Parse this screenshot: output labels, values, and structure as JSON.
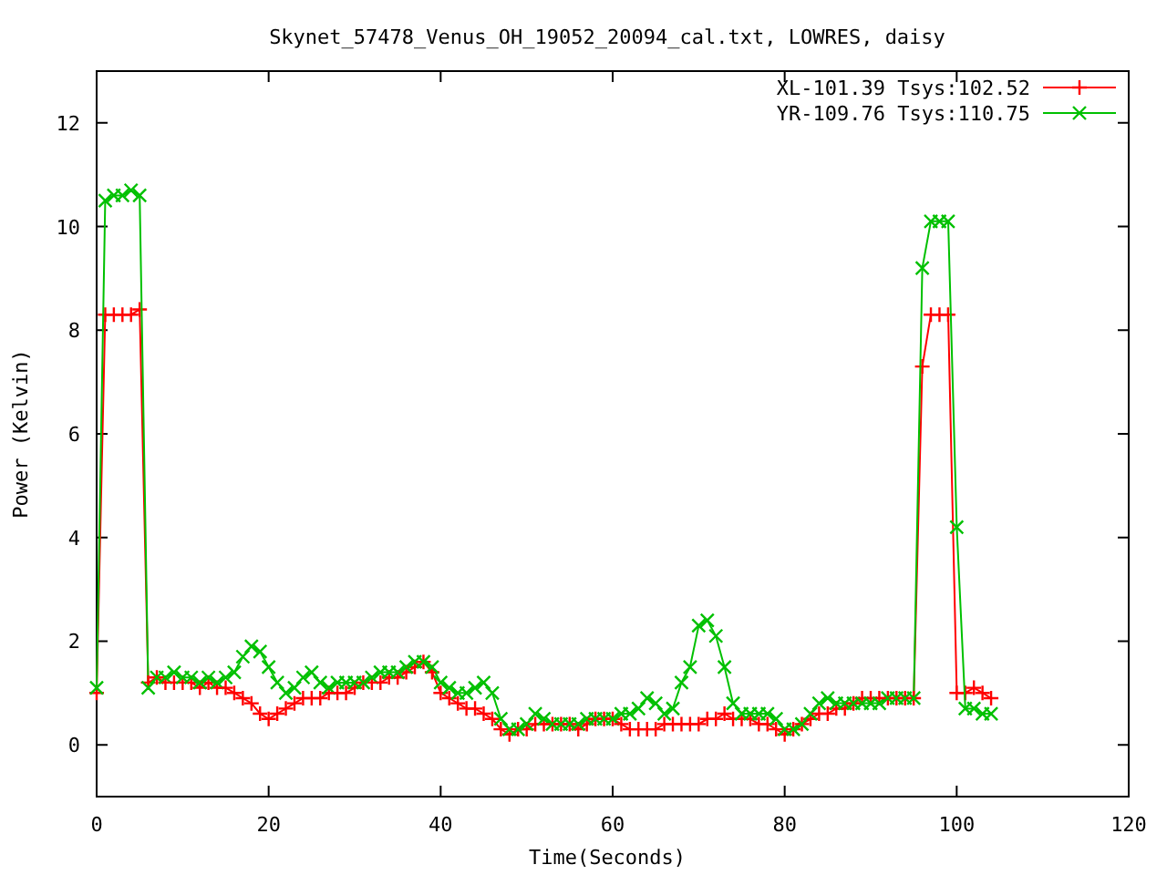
{
  "chart_data": {
    "type": "line",
    "title": "Skynet_57478_Venus_OH_19052_20094_cal.txt, LOWRES, daisy",
    "xlabel": "Time(Seconds)",
    "ylabel": "Power (Kelvin)",
    "x": [
      0,
      1,
      2,
      3,
      4,
      5,
      6,
      7,
      8,
      9,
      10,
      11,
      12,
      13,
      14,
      15,
      16,
      17,
      18,
      19,
      20,
      21,
      22,
      23,
      24,
      25,
      26,
      27,
      28,
      29,
      30,
      31,
      32,
      33,
      34,
      35,
      36,
      37,
      38,
      39,
      40,
      41,
      42,
      43,
      44,
      45,
      46,
      47,
      48,
      49,
      50,
      51,
      52,
      53,
      54,
      55,
      56,
      57,
      58,
      59,
      60,
      61,
      62,
      63,
      64,
      65,
      66,
      67,
      68,
      69,
      70,
      71,
      72,
      73,
      74,
      75,
      76,
      77,
      78,
      79,
      80,
      81,
      82,
      83,
      84,
      85,
      86,
      87,
      88,
      89,
      90,
      91,
      92,
      93,
      94,
      95,
      96,
      97,
      98,
      99,
      100,
      101,
      102,
      103,
      104
    ],
    "series": [
      {
        "name": "XL-101.39 Tsys:102.52",
        "color": "#ff0000",
        "marker": "plus",
        "values": [
          1.0,
          8.3,
          8.3,
          8.3,
          8.3,
          8.4,
          1.2,
          1.3,
          1.2,
          1.2,
          1.2,
          1.2,
          1.1,
          1.2,
          1.1,
          1.1,
          1.0,
          0.9,
          0.8,
          0.6,
          0.5,
          0.6,
          0.7,
          0.8,
          0.9,
          0.9,
          0.9,
          1.0,
          1.0,
          1.0,
          1.1,
          1.2,
          1.2,
          1.2,
          1.3,
          1.3,
          1.4,
          1.5,
          1.6,
          1.4,
          1.0,
          0.9,
          0.8,
          0.7,
          0.7,
          0.6,
          0.5,
          0.3,
          0.2,
          0.3,
          0.3,
          0.4,
          0.4,
          0.4,
          0.4,
          0.4,
          0.3,
          0.4,
          0.5,
          0.5,
          0.5,
          0.4,
          0.3,
          0.3,
          0.3,
          0.3,
          0.4,
          0.4,
          0.4,
          0.4,
          0.4,
          0.5,
          0.5,
          0.6,
          0.5,
          0.5,
          0.5,
          0.4,
          0.4,
          0.3,
          0.2,
          0.3,
          0.4,
          0.5,
          0.6,
          0.6,
          0.7,
          0.7,
          0.8,
          0.9,
          0.9,
          0.9,
          0.9,
          0.9,
          0.9,
          0.9,
          7.3,
          8.3,
          8.3,
          8.3,
          1.0,
          1.0,
          1.1,
          1.0,
          0.9
        ]
      },
      {
        "name": "YR-109.76 Tsys:110.75",
        "color": "#00c000",
        "marker": "cross",
        "values": [
          1.1,
          10.5,
          10.6,
          10.6,
          10.7,
          10.6,
          1.1,
          1.3,
          1.3,
          1.4,
          1.3,
          1.3,
          1.2,
          1.3,
          1.2,
          1.3,
          1.4,
          1.7,
          1.9,
          1.8,
          1.5,
          1.2,
          1.0,
          1.1,
          1.3,
          1.4,
          1.2,
          1.1,
          1.2,
          1.2,
          1.2,
          1.2,
          1.3,
          1.4,
          1.4,
          1.4,
          1.5,
          1.6,
          1.6,
          1.5,
          1.2,
          1.1,
          1.0,
          1.0,
          1.1,
          1.2,
          1.0,
          0.5,
          0.3,
          0.3,
          0.4,
          0.6,
          0.5,
          0.4,
          0.4,
          0.4,
          0.4,
          0.5,
          0.5,
          0.5,
          0.5,
          0.6,
          0.6,
          0.7,
          0.9,
          0.8,
          0.6,
          0.7,
          1.2,
          1.5,
          2.3,
          2.4,
          2.1,
          1.5,
          0.8,
          0.6,
          0.6,
          0.6,
          0.6,
          0.5,
          0.3,
          0.3,
          0.4,
          0.6,
          0.8,
          0.9,
          0.8,
          0.8,
          0.8,
          0.8,
          0.8,
          0.8,
          0.9,
          0.9,
          0.9,
          0.9,
          9.2,
          10.1,
          10.1,
          10.1,
          4.2,
          0.7,
          0.7,
          0.6,
          0.6
        ]
      }
    ],
    "legend": true,
    "xlim": [
      0,
      120
    ],
    "ylim": [
      -1,
      13
    ],
    "xticks": [
      0,
      20,
      40,
      60,
      80,
      100,
      120
    ],
    "yticks": [
      0,
      2,
      4,
      6,
      8,
      10,
      12
    ]
  }
}
